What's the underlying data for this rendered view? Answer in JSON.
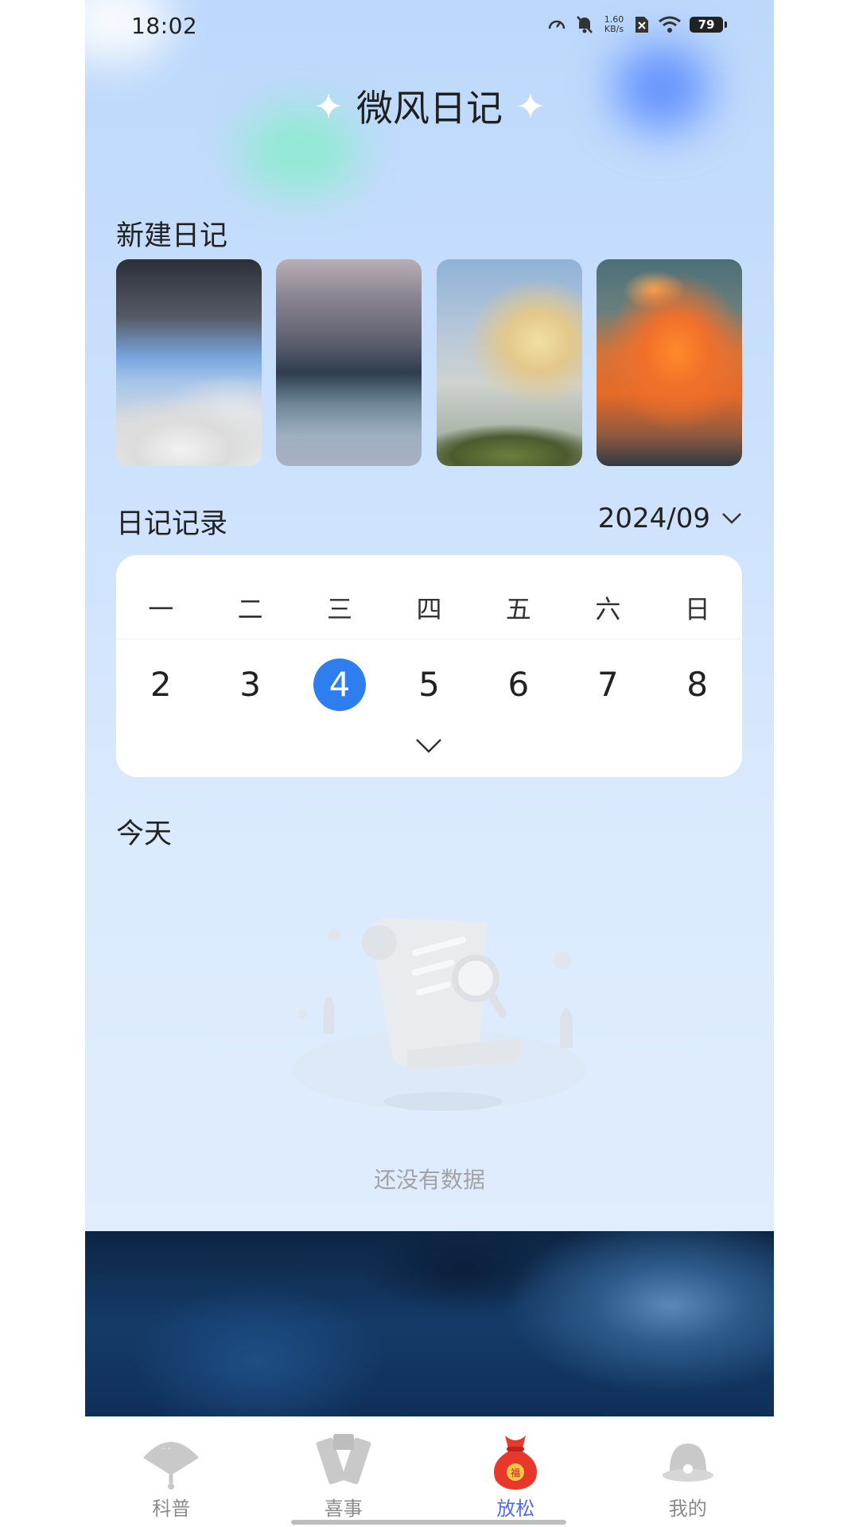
{
  "status_bar": {
    "time": "18:02",
    "network_speed_value": "1.60",
    "network_speed_unit": "KB/s",
    "battery": "79",
    "icons": [
      "speed-meter-icon",
      "bell-muted-icon",
      "network-speed",
      "sim-x-icon",
      "wifi-icon",
      "battery-icon"
    ]
  },
  "header": {
    "title": "微风日记"
  },
  "new_diary": {
    "label": "新建日记",
    "cards": [
      "stormy-sky-card",
      "glitter-surface-card",
      "rainbow-clouds-card",
      "sunset-clouds-card"
    ]
  },
  "diary_records": {
    "label": "日记记录",
    "month": "2024/09",
    "weekdays": [
      "一",
      "二",
      "三",
      "四",
      "五",
      "六",
      "日"
    ],
    "days": [
      "2",
      "3",
      "4",
      "5",
      "6",
      "7",
      "8"
    ],
    "selected_day": "4"
  },
  "today": {
    "label": "今天",
    "empty_text": "还没有数据"
  },
  "tabbar": {
    "tabs": [
      {
        "label": "科普",
        "icon": "fan-icon"
      },
      {
        "label": "喜事",
        "icon": "couplets-icon"
      },
      {
        "label": "放松",
        "icon": "lucky-bag-icon"
      },
      {
        "label": "我的",
        "icon": "profile-icon"
      }
    ],
    "active": "放松"
  },
  "colors": {
    "accent": "#2f7ef0",
    "active_tab": "#4f6bf0",
    "muted_text": "#a3a3a3"
  }
}
